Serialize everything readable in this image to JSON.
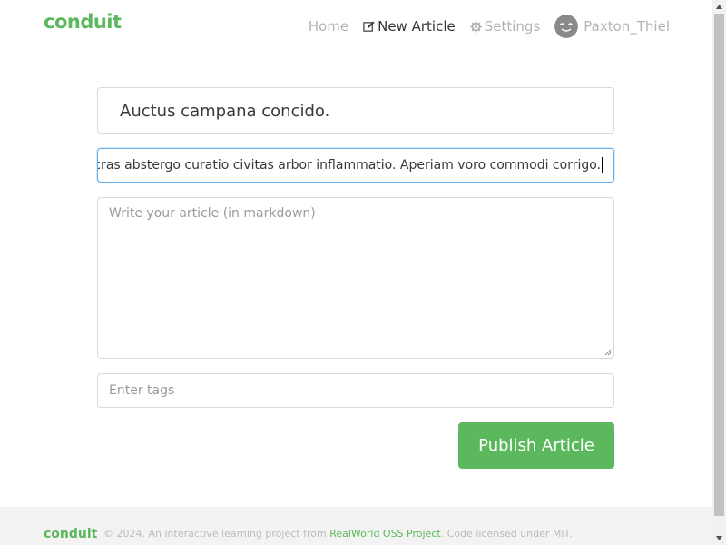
{
  "navbar": {
    "brand": "conduit",
    "items": [
      {
        "label": "Home",
        "icon": null,
        "active": false
      },
      {
        "label": "New Article",
        "icon": "edit-icon",
        "active": true
      },
      {
        "label": "Settings",
        "icon": "gear-icon",
        "active": false
      },
      {
        "label": "Paxton_Thiel",
        "icon": "avatar",
        "active": false
      }
    ]
  },
  "editor": {
    "title_value": "Auctus campana concido.",
    "about_value": "cras abstergo curatio civitas arbor inflammatio. Aperiam voro commodi corrigo.",
    "body_placeholder": "Write your article (in markdown)",
    "tags_placeholder": "Enter tags",
    "publish_label": "Publish Article"
  },
  "footer": {
    "brand": "conduit",
    "text_before": "© 2024. An interactive learning project from ",
    "link": "RealWorld OSS Project",
    "text_after": ". Code licensed under MIT."
  },
  "colors": {
    "accent": "#5cb85c",
    "focus_border": "#66afe9"
  }
}
